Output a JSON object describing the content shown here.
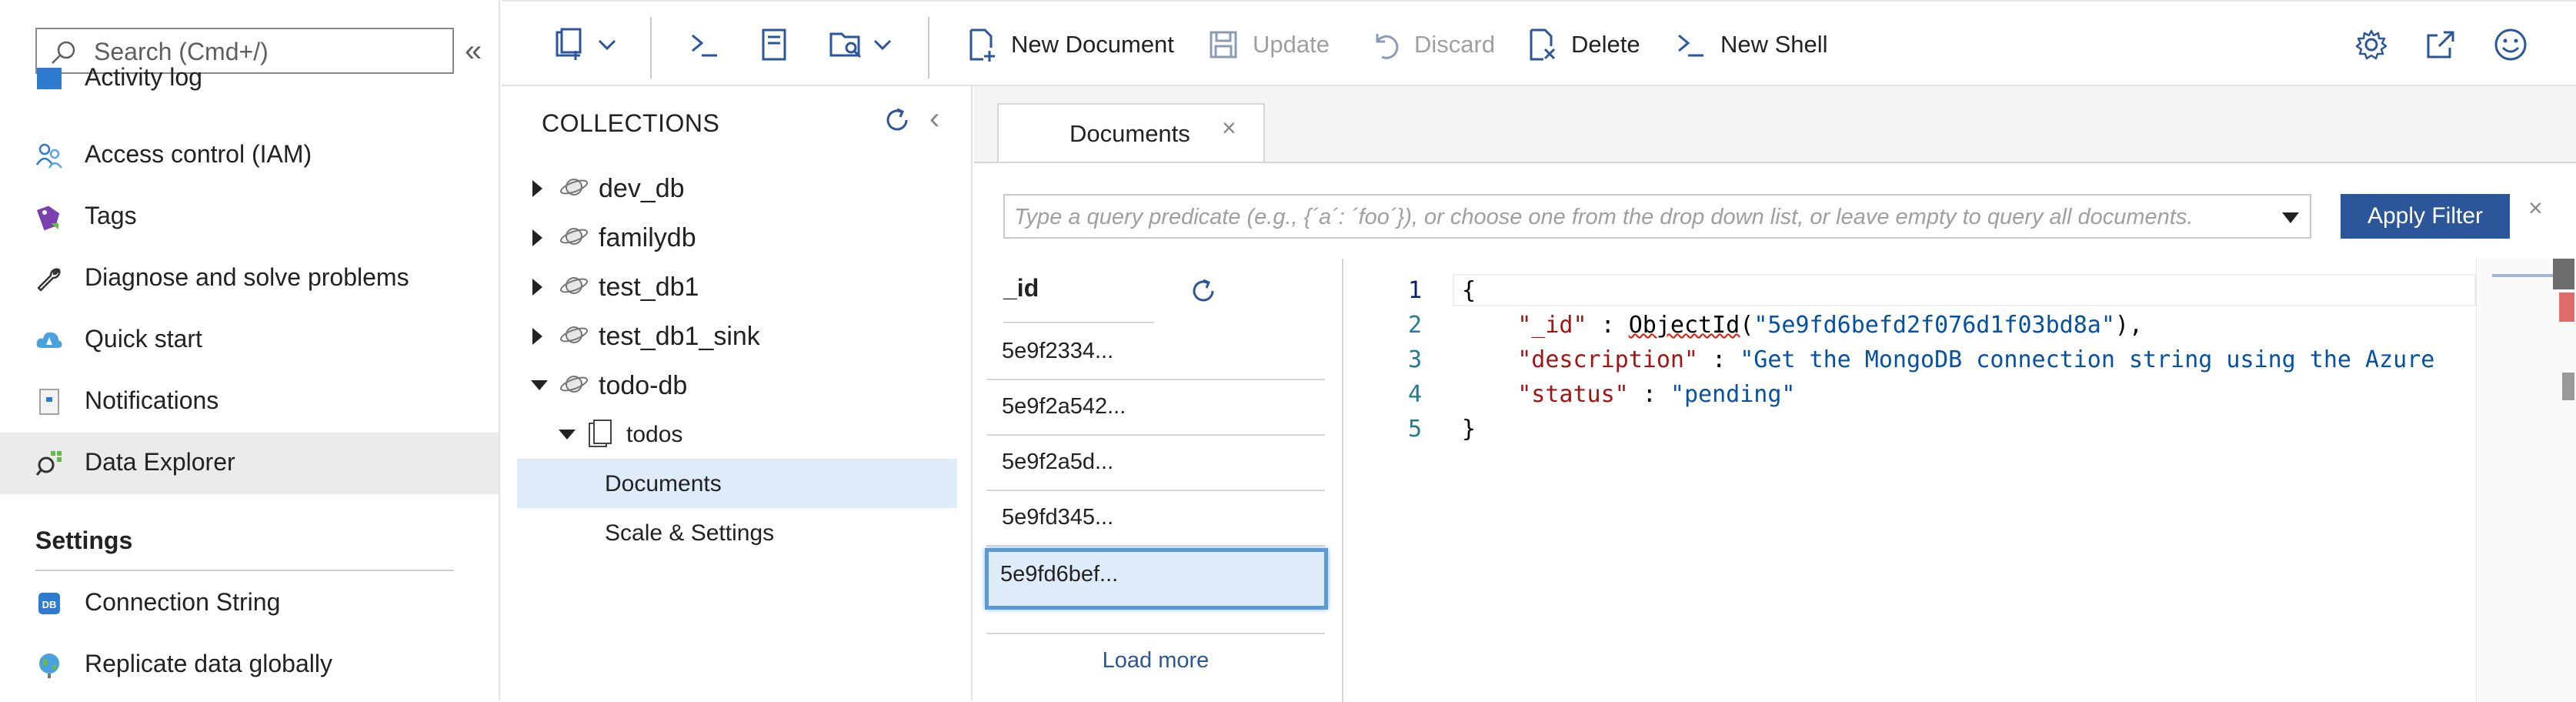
{
  "nav": {
    "search_placeholder": "Search (Cmd+/)",
    "collapse_glyph": "«",
    "items": [
      {
        "label": "Activity log",
        "icon": "activity-log-icon"
      },
      {
        "label": "Access control (IAM)",
        "icon": "people-icon"
      },
      {
        "label": "Tags",
        "icon": "tag-icon"
      },
      {
        "label": "Diagnose and solve problems",
        "icon": "wrench-icon"
      },
      {
        "label": "Quick start",
        "icon": "cloud-icon"
      },
      {
        "label": "Notifications",
        "icon": "notification-icon"
      },
      {
        "label": "Data Explorer",
        "icon": "data-explorer-icon"
      }
    ],
    "settings_heading": "Settings",
    "settings_items": [
      {
        "label": "Connection String",
        "icon": "database-icon"
      },
      {
        "label": "Replicate data globally",
        "icon": "globe-icon"
      }
    ]
  },
  "toolbar": {
    "new_document": "New Document",
    "update": "Update",
    "discard": "Discard",
    "delete": "Delete",
    "new_shell": "New Shell"
  },
  "collections": {
    "title": "COLLECTIONS",
    "databases": [
      "dev_db",
      "familydb",
      "test_db1",
      "test_db1_sink",
      "todo-db"
    ],
    "collection": "todos",
    "children": [
      "Documents",
      "Scale & Settings"
    ]
  },
  "documents": {
    "tab_label": "Documents",
    "tab_close": "×",
    "filter_placeholder": "Type a query predicate (e.g., {´a´: ´foo´}), or choose one from the drop down list, or leave empty to query all documents.",
    "apply_filter": "Apply Filter",
    "filter_close": "×",
    "id_header": "_id",
    "ids": [
      "5e9f2334...",
      "5e9f2a542...",
      "5e9f2a5d...",
      "5e9fd345...",
      "5e9fd6bef..."
    ],
    "selected_index": 4,
    "load_more": "Load more"
  },
  "editor": {
    "line_numbers": [
      "1",
      "2",
      "3",
      "4",
      "5"
    ],
    "open_brace": "{",
    "close_brace": "}",
    "id_key": "\"_id\"",
    "id_func": "ObjectId",
    "id_value": "\"5e9fd6befd2f076d1f03bd8a\"",
    "description_key": "\"description\"",
    "description_value": "\"Get the MongoDB connection string using the Azure",
    "status_key": "\"status\"",
    "status_value": "\"pending\""
  },
  "colors": {
    "accent": "#2b579a",
    "selected_bg": "#deecf9",
    "json_key": "#a31515",
    "json_string": "#0451a5"
  }
}
